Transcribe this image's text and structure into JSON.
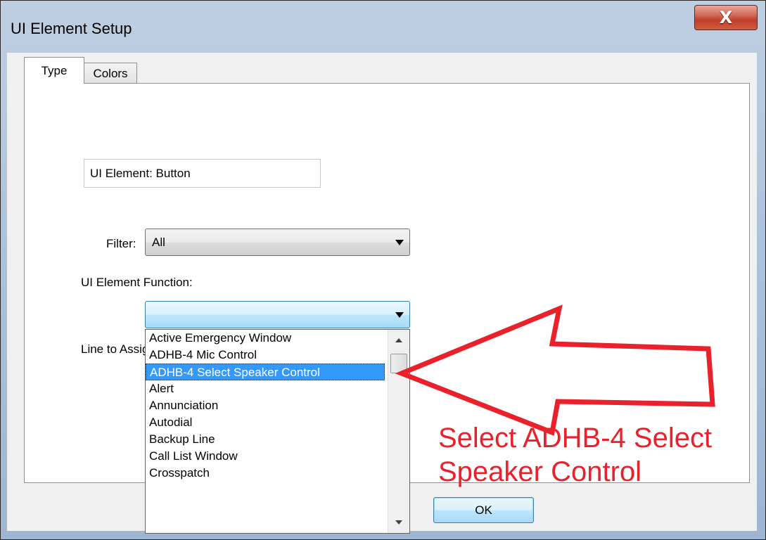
{
  "window": {
    "title": "UI Element Setup"
  },
  "tabs": [
    {
      "label": "Type",
      "active": true
    },
    {
      "label": "Colors",
      "active": false
    }
  ],
  "form": {
    "element_field": "UI Element: Button",
    "filter_label": "Filter:",
    "filter_value": "All",
    "function_label": "UI Element Function:",
    "function_value": "",
    "line_label": "Line to Assign:"
  },
  "function_list": {
    "items": [
      "Active Emergency Window",
      "ADHB-4 Mic Control",
      "ADHB-4 Select Speaker Control",
      "Alert",
      "Annunciation",
      "Autodial",
      "Backup Line",
      "Call List Window",
      "Crosspatch"
    ],
    "selected_index": 2
  },
  "annotation": {
    "line1": "Select ADHB-4 Select",
    "line2": "Speaker Control",
    "color": "#e8212b"
  },
  "buttons": {
    "ok": "OK",
    "close": "X"
  },
  "colors": {
    "selection": "#3399ff",
    "annotation": "#e8212b"
  }
}
